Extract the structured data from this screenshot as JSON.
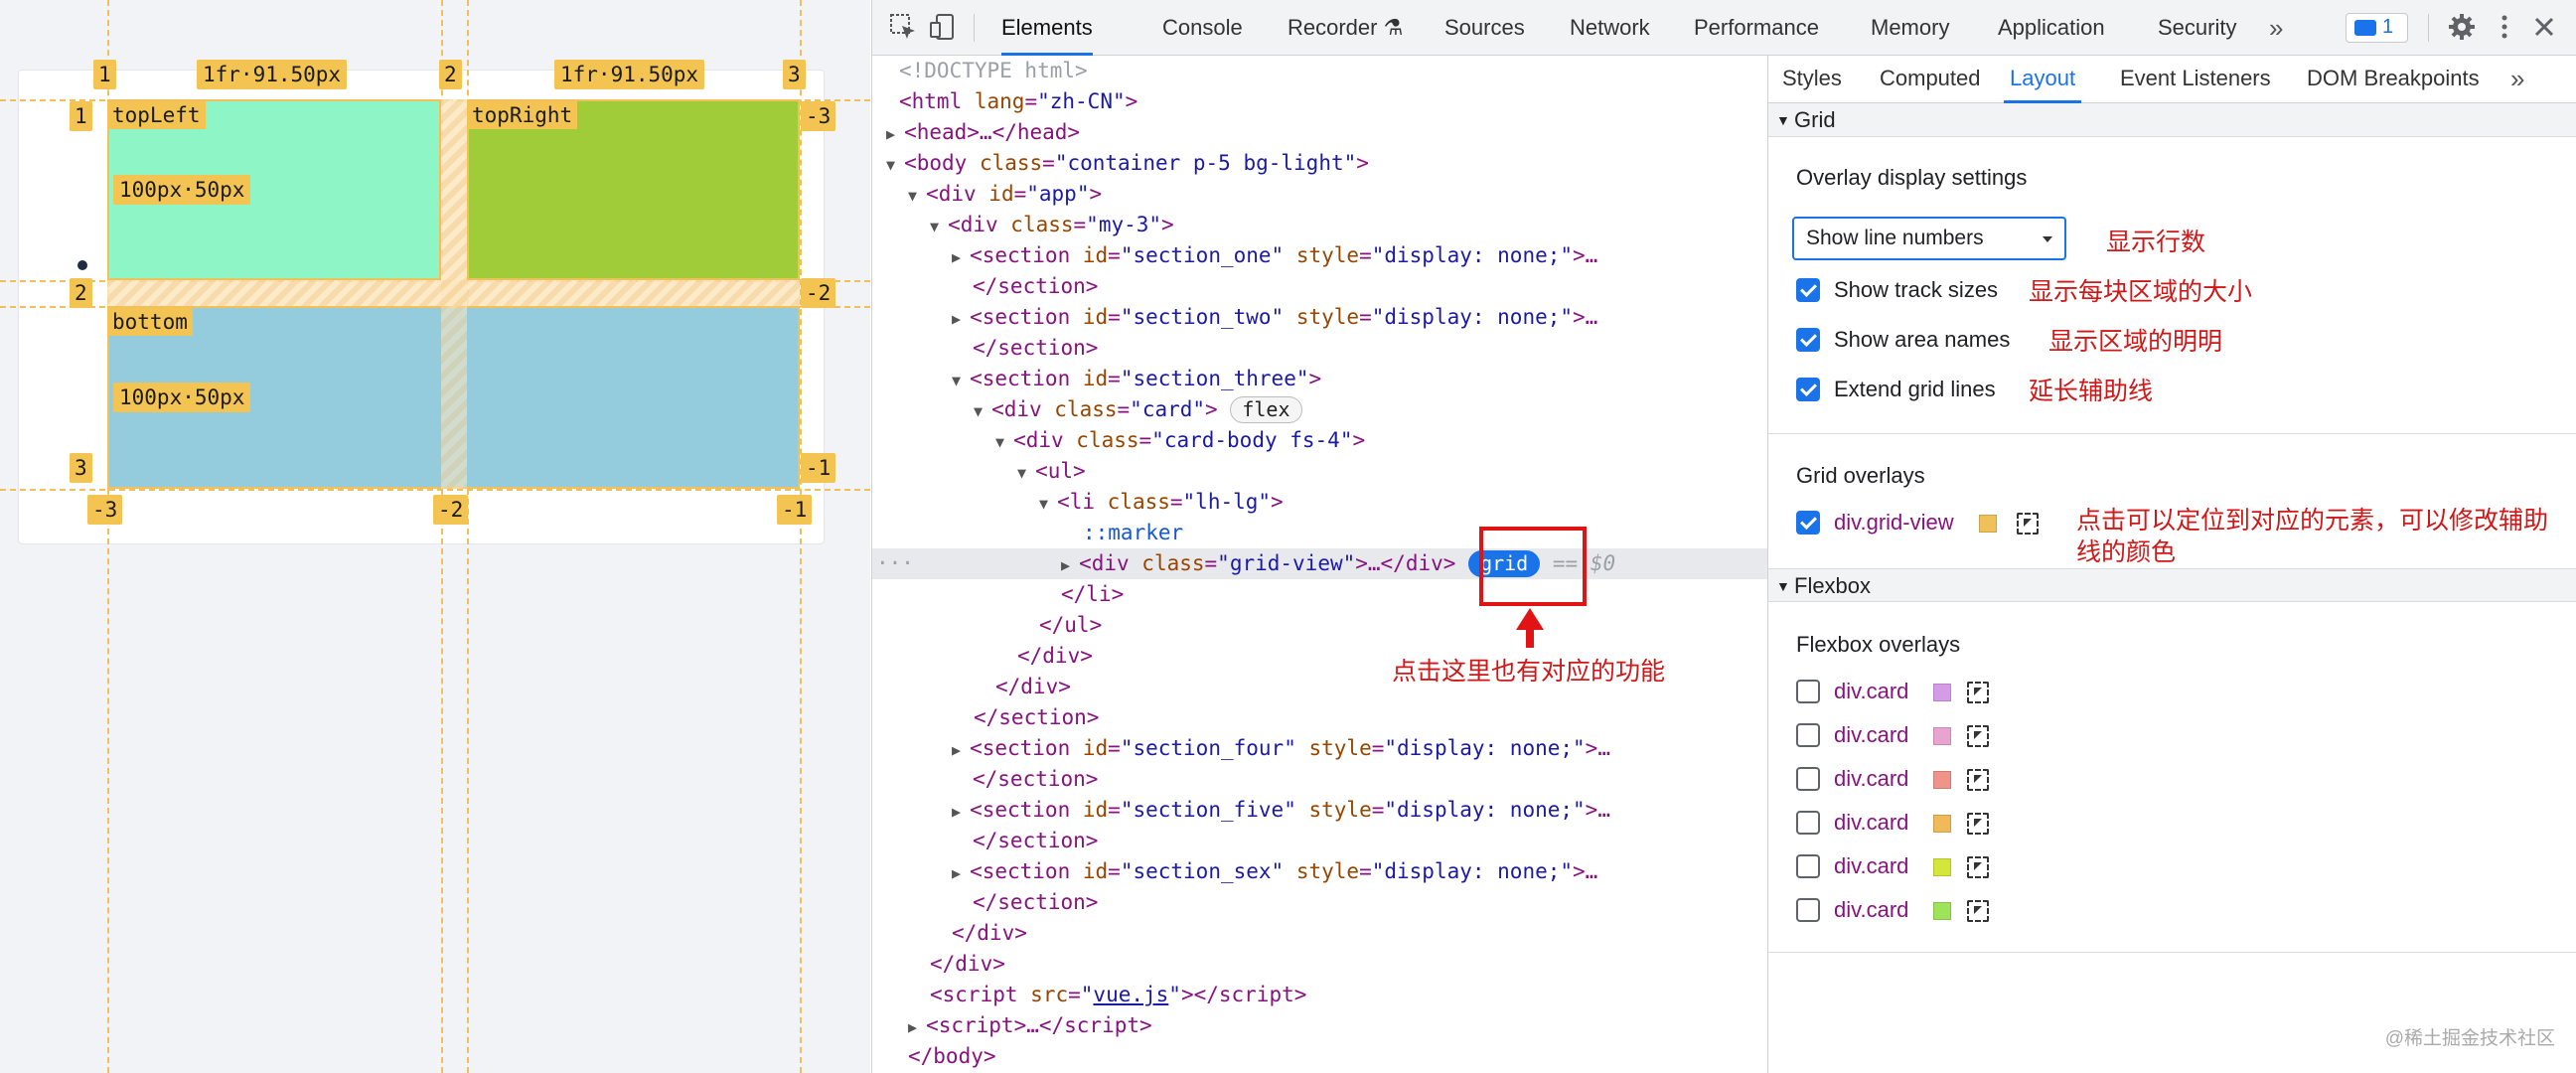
{
  "preview": {
    "area_names": [
      "topLeft",
      "topRight",
      "bottom"
    ],
    "column_sizes": [
      "1fr·91.50px",
      "1fr·91.50px"
    ],
    "row_sizes": [
      "100px·50px",
      "100px·50px"
    ],
    "positive_line_numbers": [
      "1",
      "2",
      "3"
    ],
    "negative_line_numbers": [
      "-3",
      "-2",
      "-1"
    ],
    "row_line_numbers": [
      "1",
      "2",
      "3"
    ],
    "row_negative_line_numbers": [
      "-3",
      "-2",
      "-1"
    ],
    "colors": {
      "top_left": "#8ef5c6",
      "top_right": "#a0cc3a",
      "bottom": "#94ccde",
      "overlay": "#f0c05a"
    }
  },
  "toolbar": {
    "tabs": [
      "Elements",
      "Console",
      "Recorder ⚗",
      "Sources",
      "Network",
      "Performance",
      "Memory",
      "Application",
      "Security"
    ],
    "active_tab": "Elements",
    "more": "»",
    "issues_count": "1"
  },
  "tree": {
    "doctype": "<!DOCTYPE html>",
    "html_open": "<html",
    "lang_attr": "lang",
    "lang_val": "\"zh-CN\"",
    "head": "<head>…</head>",
    "body_tag": "<body",
    "body_class": "\"container p-5 bg-light\"",
    "div_app": "\"app\"",
    "div_my3": "\"my-3\"",
    "section_one": "\"section_one\"",
    "section_two": "\"section_two\"",
    "section_three": "\"section_three\"",
    "card": "\"card\"",
    "card_body": "\"card-body fs-4\"",
    "li_class": "\"lh-lg\"",
    "marker": "::marker",
    "grid_view": "\"grid-view\"",
    "section_four": "\"section_four\"",
    "section_five": "\"section_five\"",
    "section_sex": "\"section_sex\"",
    "display_none": "\"display: none;\"",
    "vue_src": "vue.js",
    "badge_flex": "flex",
    "badge_grid": "grid",
    "selected_marker": "== $0",
    "dots": "···"
  },
  "sidebar": {
    "tabs": [
      "Styles",
      "Computed",
      "Layout",
      "Event Listeners",
      "DOM Breakpoints"
    ],
    "active_tab": "Layout",
    "more": "»",
    "grid_section": "Grid",
    "overlay_settings": "Overlay display settings",
    "select_value": "Show line numbers",
    "checks": [
      {
        "label": "Show track sizes",
        "checked": true
      },
      {
        "label": "Show area names",
        "checked": true
      },
      {
        "label": "Extend grid lines",
        "checked": true
      }
    ],
    "grid_overlays": "Grid overlays",
    "grid_overlay_item": {
      "label": "div.grid-view",
      "checked": true,
      "color": "#f0c05a"
    },
    "flexbox_section": "Flexbox",
    "flexbox_overlays": "Flexbox overlays",
    "flex_items": [
      {
        "label": "div.card",
        "color": "#d69be6"
      },
      {
        "label": "div.card",
        "color": "#e8a3cf"
      },
      {
        "label": "div.card",
        "color": "#ef938b"
      },
      {
        "label": "div.card",
        "color": "#f0b95a"
      },
      {
        "label": "div.card",
        "color": "#d5e63a"
      },
      {
        "label": "div.card",
        "color": "#9ee35a"
      }
    ]
  },
  "annotations": {
    "line_numbers": "显示行数",
    "track_sizes": "显示每块区域的大小",
    "area_names": "显示区域的明明",
    "extend_lines": "延长辅助线",
    "overlay_note": "点击可以定位到对应的元素，可以修改辅助线的颜色",
    "badge_note": "点击这里也有对应的功能"
  },
  "watermark": "@稀土掘金技术社区"
}
